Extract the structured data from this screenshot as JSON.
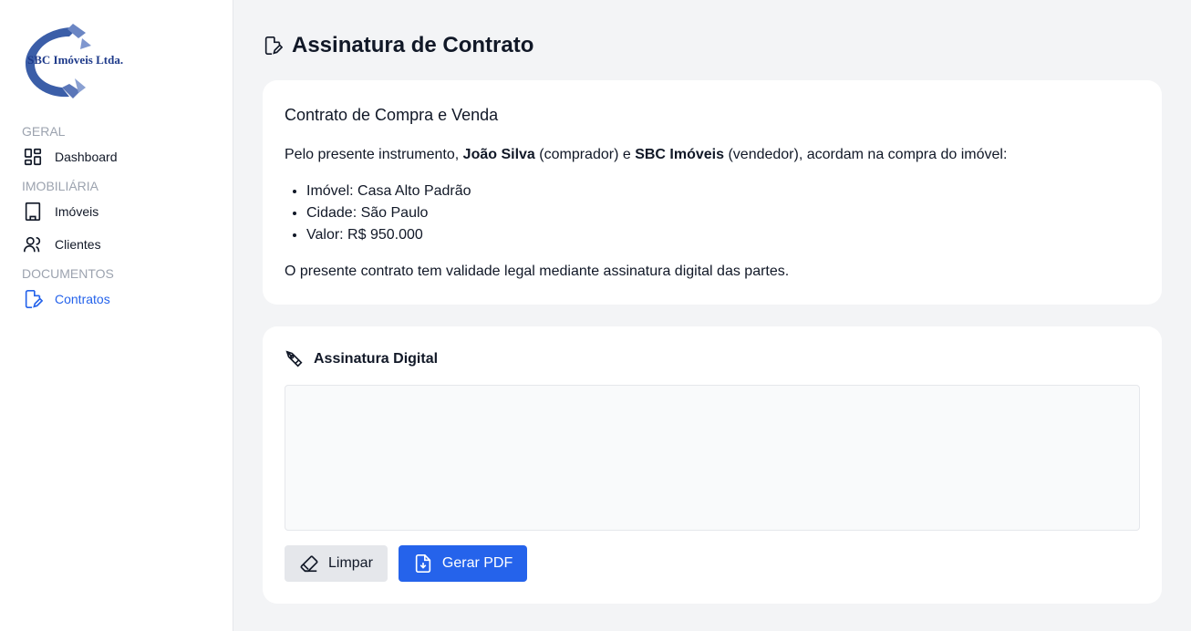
{
  "brand": {
    "logo_text": "SBC Imóveis Ltda.",
    "accent_color": "#2563eb",
    "logo_color": "#1e3a8a"
  },
  "sidebar": {
    "sections": [
      {
        "label": "GERAL",
        "items": [
          {
            "label": "Dashboard",
            "icon": "dashboard-icon",
            "active": false
          }
        ]
      },
      {
        "label": "IMOBILIÁRIA",
        "items": [
          {
            "label": "Imóveis",
            "icon": "building-icon",
            "active": false
          },
          {
            "label": "Clientes",
            "icon": "users-icon",
            "active": false
          }
        ]
      },
      {
        "label": "DOCUMENTOS",
        "items": [
          {
            "label": "Contratos",
            "icon": "contract-icon",
            "active": true
          }
        ]
      }
    ]
  },
  "page": {
    "title": "Assinatura de Contrato",
    "title_icon": "contract-edit-icon"
  },
  "contract": {
    "title": "Contrato de Compra e Venda",
    "intro_prefix": "Pelo presente instrumento, ",
    "buyer": "João Silva",
    "buyer_role": " (comprador) e ",
    "seller": "SBC Imóveis",
    "seller_role": " (vendedor), acordam na compra do imóvel:",
    "items": [
      "Imóvel: Casa Alto Padrão",
      "Cidade: São Paulo",
      "Valor: R$ 950.000"
    ],
    "footer": "O presente contrato tem validade legal mediante assinatura digital das partes."
  },
  "signature": {
    "title": "Assinatura Digital",
    "icon": "pen-signature-icon",
    "clear_label": "Limpar",
    "pdf_label": "Gerar PDF"
  }
}
